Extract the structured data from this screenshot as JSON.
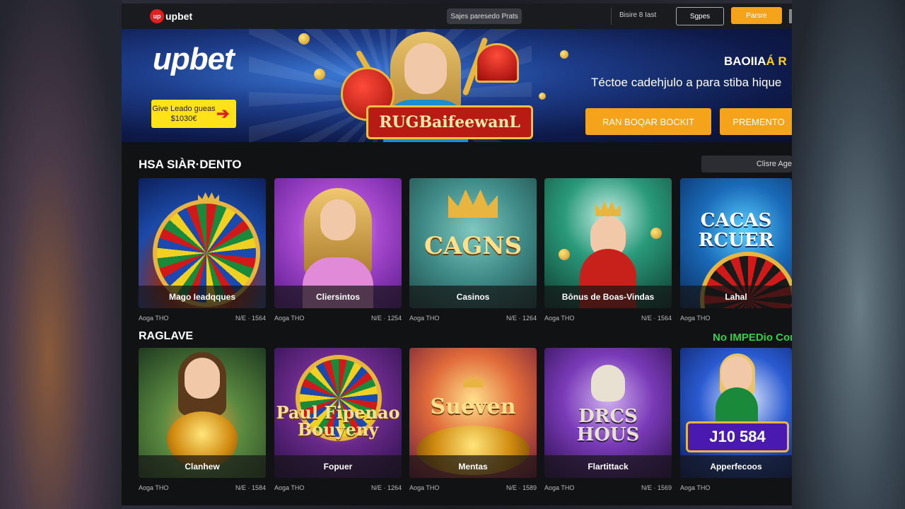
{
  "header": {
    "logo_badge": "up",
    "logo_text": "upbet",
    "search_label": "Sajes paresedo Prats",
    "lang_link": "Bisire 8 Iast",
    "login_label": "Sgpes",
    "register_label": "Parsre"
  },
  "hero": {
    "logo_text": "upbet",
    "promo_text": "Give Leado gueas $1030€",
    "promo_arrow": "➔",
    "banner_text": "RUGBaifeewanL",
    "title_part1": "BAOIIA",
    "title_part2": "Á R",
    "subtitle": "Téctoe cadehjulo a para stiba hique",
    "button1_label": "RAN BOQAR BOCKIT",
    "button2_label": "PREMENTO"
  },
  "section1": {
    "title": "HSA SIÀR·DENTO",
    "view_all_label": "Clisre Age",
    "cards": [
      {
        "label": "Mago Ieadqques",
        "provider": "Aoga THO",
        "meta": "N/E · 1564",
        "art_text": ""
      },
      {
        "label": "Cliersintos",
        "provider": "Aoga THO",
        "meta": "N/E · 1254",
        "art_text": ""
      },
      {
        "label": "Casinos",
        "provider": "Aoga THO",
        "meta": "N/E · 1264",
        "art_text": "CAGNS"
      },
      {
        "label": "Bōnus de Boas-Vindas",
        "provider": "Aoga THO",
        "meta": "N/E · 1564",
        "art_text": ""
      },
      {
        "label": "Lahal",
        "provider": "Aoga THO",
        "meta": "",
        "art_text": "CACAS RCUER"
      }
    ]
  },
  "section2": {
    "title": "RAGLAVE",
    "link_label": "No IMPEDio Con",
    "cards": [
      {
        "label": "Clanhew",
        "provider": "Aoga THO",
        "meta": "N/E · 1584",
        "art_text": ""
      },
      {
        "label": "Fopuer",
        "provider": "Aoga THO",
        "meta": "N/E · 1264",
        "art_text": "Paul Fipenao Bouyeny"
      },
      {
        "label": "Mentas",
        "provider": "Aoga THO",
        "meta": "N/E · 1589",
        "art_text": "Sueven"
      },
      {
        "label": "Flartittack",
        "provider": "Aoga THO",
        "meta": "N/E · 1569",
        "art_text": "DRCS HOUS"
      },
      {
        "label": "Apperfecoos",
        "provider": "Aoga THO",
        "meta": "",
        "art_text": "J10 584"
      }
    ]
  },
  "colors": {
    "accent_orange": "#f4a31a",
    "promo_yellow": "#ffe21a",
    "link_green": "#2ed14a",
    "brand_red": "#e0201e"
  }
}
